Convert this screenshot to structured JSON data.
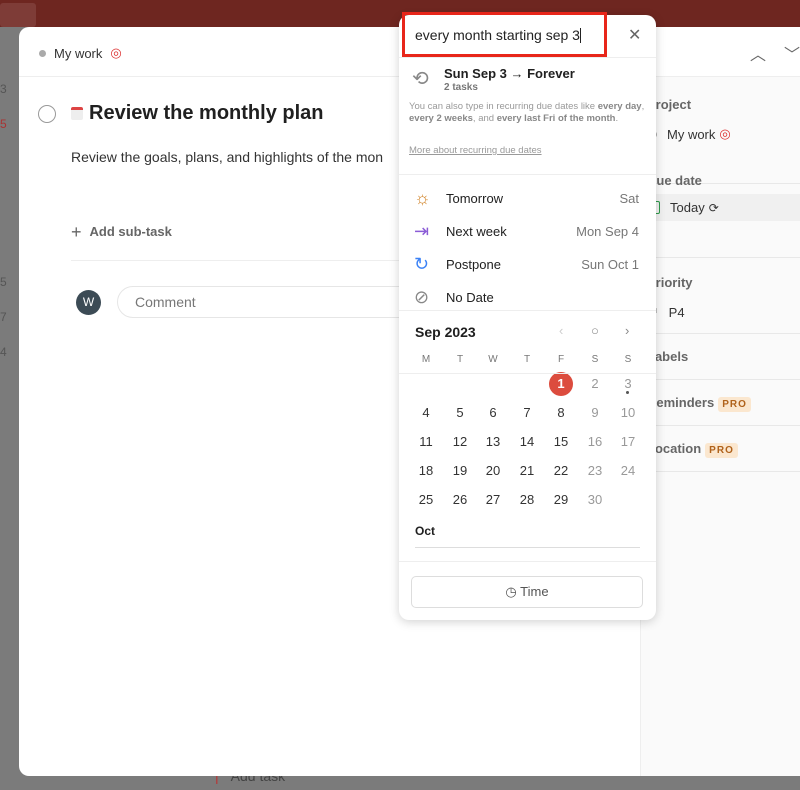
{
  "background": {
    "side_numbers": [
      "3",
      "5",
      "5",
      "7",
      "4"
    ],
    "add_task": "Add task"
  },
  "task": {
    "project": "My work",
    "title": "Review the monthly plan",
    "description": "Review the goals, plans, and highlights of the mon",
    "add_subtask": "Add sub-task",
    "avatar_initial": "W",
    "comment_placeholder": "Comment"
  },
  "sidebar": {
    "project_label": "Project",
    "project_value": "My work",
    "due_label": "Due date",
    "due_value": "Today",
    "priority_label": "Priority",
    "priority_value": "P4",
    "labels_label": "Labels",
    "reminders_label": "Reminders",
    "location_label": "Location",
    "pro_badge": "PRO"
  },
  "picker": {
    "input_value": "every month starting sep 3",
    "recurring_title": "Sun Sep 3 → Forever",
    "recurring_count": "2 tasks",
    "hint_pre": "You can also type in recurring due dates like ",
    "hint_b1": "every day",
    "hint_c1": ", ",
    "hint_b2": "every 2 weeks",
    "hint_c2": ", and ",
    "hint_b3": "every last Fri of the month",
    "hint_end": ".",
    "more_link": "More about recurring due dates",
    "options": [
      {
        "name": "Tomorrow",
        "date": "Sat",
        "icon": "sun-icon",
        "color": "#d1842a"
      },
      {
        "name": "Next week",
        "date": "Mon Sep 4",
        "icon": "next-week-icon",
        "color": "#8b5cd6"
      },
      {
        "name": "Postpone",
        "date": "Sun Oct 1",
        "icon": "postpone-icon",
        "color": "#3b82f6"
      },
      {
        "name": "No Date",
        "date": "",
        "icon": "no-date-icon",
        "color": "#888"
      }
    ],
    "month": "Sep 2023",
    "weekdays": [
      "M",
      "T",
      "W",
      "T",
      "F",
      "S",
      "S"
    ],
    "days": [
      "1",
      "2",
      "3",
      "4",
      "5",
      "6",
      "7",
      "8",
      "9",
      "10",
      "11",
      "12",
      "13",
      "14",
      "15",
      "16",
      "17",
      "18",
      "19",
      "20",
      "21",
      "22",
      "23",
      "24",
      "25",
      "26",
      "27",
      "28",
      "29",
      "30"
    ],
    "today": "1",
    "next_month": "Oct",
    "time_button": "Time",
    "accent": "#dc4c3e"
  }
}
